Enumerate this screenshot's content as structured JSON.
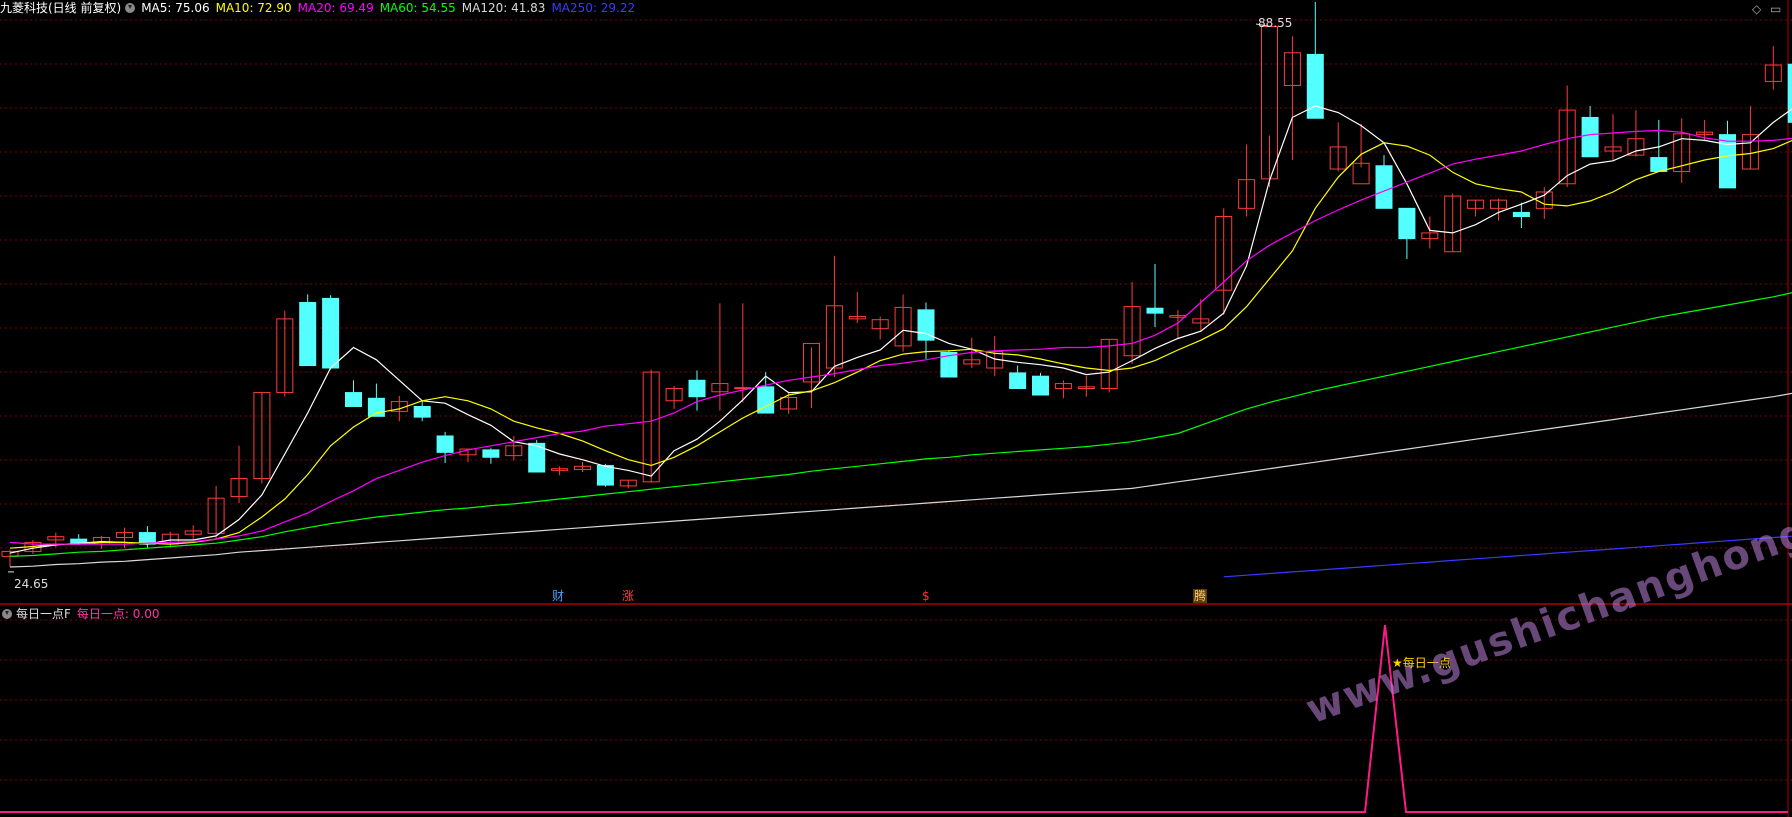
{
  "header": {
    "title": "九菱科技(日线 前复权)",
    "ma": [
      {
        "label": "MA5: 75.06",
        "color": "#ffffff"
      },
      {
        "label": "MA10: 72.90",
        "color": "#ffff00"
      },
      {
        "label": "MA20: 69.49",
        "color": "#ff00ff"
      },
      {
        "label": "MA60: 54.55",
        "color": "#00ff00"
      },
      {
        "label": "MA120: 41.83",
        "color": "#d8d8d8"
      },
      {
        "label": "MA250: 29.22",
        "color": "#3a3aff"
      }
    ]
  },
  "price_labels": {
    "high": "88.55",
    "low": "24.65"
  },
  "event_tags": [
    {
      "text": "财",
      "color": "#4aa3ff"
    },
    {
      "text": "涨",
      "color": "#ff4040"
    },
    {
      "text": "$",
      "color": "#ff3030"
    },
    {
      "text": "腾",
      "color": "#ffcc66"
    }
  ],
  "indicator": {
    "name": "每日一点F",
    "value_label": "每日一点: 0.00",
    "signal_label": "★每日一点"
  },
  "watermark": "www.gushichanghong.com",
  "colors": {
    "up": "#ff3b3b",
    "down": "#54ffff",
    "grid": "#7a0000"
  },
  "chart_data": {
    "type": "candlestick",
    "candles": [
      [
        26.5,
        27.3,
        25.2,
        27.1
      ],
      [
        27.1,
        28.5,
        26.8,
        28.2
      ],
      [
        28.5,
        29.4,
        27.6,
        28.9
      ],
      [
        28.6,
        29.2,
        27.9,
        28.0
      ],
      [
        28.0,
        29.0,
        27.4,
        28.8
      ],
      [
        28.8,
        30.0,
        27.5,
        29.4
      ],
      [
        29.4,
        30.2,
        27.5,
        28.0
      ],
      [
        28.0,
        29.5,
        27.6,
        29.2
      ],
      [
        29.2,
        30.3,
        28.6,
        29.6
      ],
      [
        29.3,
        35.1,
        28.6,
        33.6
      ],
      [
        33.8,
        40.0,
        33.0,
        36.0
      ],
      [
        36.0,
        46.5,
        35.4,
        46.5
      ],
      [
        46.5,
        56.5,
        46.0,
        55.5
      ],
      [
        57.5,
        58.5,
        50.0,
        49.8
      ],
      [
        58.0,
        58.4,
        49.3,
        49.5
      ],
      [
        46.5,
        48.0,
        45.2,
        44.8
      ],
      [
        45.8,
        47.6,
        44.5,
        43.6
      ],
      [
        44.2,
        46.1,
        43.0,
        45.4
      ],
      [
        44.8,
        45.5,
        43.0,
        43.5
      ],
      [
        41.2,
        41.7,
        37.9,
        39.2
      ],
      [
        38.9,
        39.5,
        38.0,
        39.6
      ],
      [
        39.5,
        39.7,
        37.8,
        38.6
      ],
      [
        38.8,
        41.2,
        38.2,
        40.0
      ],
      [
        40.3,
        40.7,
        36.8,
        36.8
      ],
      [
        37.0,
        37.5,
        36.4,
        37.2
      ],
      [
        37.1,
        38.0,
        36.8,
        37.5
      ],
      [
        37.6,
        37.8,
        35.0,
        35.2
      ],
      [
        35.1,
        35.8,
        34.8,
        35.8
      ],
      [
        35.6,
        49.3,
        35.5,
        49.0
      ],
      [
        45.5,
        47.3,
        44.5,
        47.0
      ],
      [
        48.0,
        49.2,
        44.3,
        46.0
      ],
      [
        46.6,
        57.4,
        44.3,
        47.6
      ],
      [
        47.0,
        57.4,
        45.3,
        47.1
      ],
      [
        47.2,
        49.0,
        45.0,
        44.0
      ],
      [
        44.5,
        46.6,
        43.9,
        45.9
      ],
      [
        47.8,
        52.0,
        44.6,
        52.5
      ],
      [
        49.5,
        63.2,
        48.4,
        57.1
      ],
      [
        55.5,
        58.8,
        55.0,
        55.8
      ],
      [
        54.3,
        55.8,
        53.0,
        55.4
      ],
      [
        52.2,
        58.5,
        51.5,
        56.9
      ],
      [
        56.6,
        57.5,
        50.6,
        52.9
      ],
      [
        51.4,
        51.7,
        50.4,
        48.4
      ],
      [
        50.0,
        53.2,
        49.5,
        50.5
      ],
      [
        49.5,
        53.4,
        48.5,
        51.5
      ],
      [
        48.9,
        49.8,
        47.0,
        47.0
      ],
      [
        48.5,
        48.9,
        46.2,
        46.2
      ],
      [
        47.0,
        48.0,
        45.8,
        47.6
      ],
      [
        47.0,
        48.5,
        46.0,
        47.2
      ],
      [
        47.0,
        53.0,
        46.5,
        53.0
      ],
      [
        51.0,
        60.0,
        50.0,
        57.0
      ],
      [
        56.8,
        62.2,
        54.5,
        56.2
      ],
      [
        55.7,
        56.6,
        53.0,
        55.9
      ],
      [
        55.0,
        57.9,
        54.0,
        55.5
      ],
      [
        59.0,
        69.0,
        56.0,
        68.0
      ],
      [
        69.0,
        76.8,
        68.0,
        72.5
      ],
      [
        72.6,
        77.9,
        71.6,
        91.2
      ],
      [
        84.0,
        90.0,
        74.9,
        88.0
      ],
      [
        87.8,
        94.2,
        83.5,
        80.0
      ],
      [
        73.8,
        79.5,
        73.5,
        76.5
      ],
      [
        72.0,
        79.3,
        74.0,
        74.5
      ],
      [
        74.2,
        75.5,
        69.2,
        69.0
      ],
      [
        69.0,
        68.0,
        62.8,
        65.3
      ],
      [
        65.3,
        68.0,
        64.1,
        66.0
      ],
      [
        63.7,
        70.8,
        63.7,
        70.5
      ],
      [
        69.0,
        70.0,
        68.0,
        70.0
      ],
      [
        69.0,
        70.2,
        67.5,
        70.0
      ],
      [
        68.5,
        69.7,
        66.6,
        68.0
      ],
      [
        69.0,
        71.6,
        67.7,
        71.0
      ],
      [
        72.0,
        84.0,
        71.6,
        81.0
      ],
      [
        80.1,
        81.5,
        76.0,
        75.3
      ],
      [
        76.0,
        80.5,
        74.8,
        76.5
      ],
      [
        75.5,
        81.0,
        75.3,
        77.5
      ],
      [
        75.2,
        79.8,
        73.5,
        73.5
      ],
      [
        73.5,
        80.0,
        72.1,
        78.1
      ],
      [
        78.0,
        79.8,
        77.2,
        78.3
      ],
      [
        78.0,
        79.7,
        75.0,
        71.5
      ],
      [
        73.8,
        81.5,
        73.8,
        78.0
      ],
      [
        84.5,
        88.8,
        83.5,
        86.5
      ],
      [
        86.6,
        87.5,
        81.2,
        79.5
      ],
      [
        79.8,
        83.5,
        78.3,
        78.9
      ],
      [
        78.2,
        83.0,
        77.5,
        78.6
      ]
    ],
    "ma_series": [
      {
        "name": "MA5",
        "color": "#ffffff",
        "values": [
          26.9,
          27.5,
          27.9,
          28.1,
          28.3,
          28.2,
          28.0,
          28.5,
          28.5,
          29.0,
          31.0,
          34.0,
          39.0,
          44.0,
          49.5,
          52.0,
          50.5,
          48.0,
          45.5,
          45.2,
          43.8,
          42.5,
          40.5,
          40.0,
          39.0,
          38.3,
          37.5,
          37.0,
          36.3,
          39.4,
          40.8,
          43.0,
          45.6,
          48.5,
          46.5,
          46.6,
          49.7,
          50.8,
          51.7,
          54.1,
          53.7,
          52.5,
          51.8,
          50.6,
          50.2,
          49.9,
          49.5,
          48.7,
          49.0,
          50.4,
          51.9,
          53.1,
          54.0,
          56.2,
          62.0,
          72.4,
          80.1,
          81.5,
          80.7,
          79.1,
          77.0,
          72.0,
          66.3,
          66.0,
          67.0,
          68.5,
          69.5,
          70.6,
          73.0,
          74.4,
          74.8,
          76.0,
          76.5,
          77.5,
          77.3,
          76.8,
          77.0,
          79.5,
          81.5,
          82.0,
          83.8
        ]
      },
      {
        "name": "MA10",
        "color": "#ffff00",
        "values": [
          27.5,
          27.7,
          28.0,
          28.0,
          28.2,
          28.2,
          28.1,
          28.0,
          28.2,
          28.6,
          29.4,
          31.3,
          33.5,
          36.5,
          40.0,
          42.3,
          44.0,
          44.5,
          45.5,
          46.0,
          45.5,
          44.5,
          43.0,
          42.2,
          41.5,
          40.6,
          39.4,
          38.3,
          37.6,
          38.6,
          40.0,
          41.7,
          43.4,
          44.8,
          46.2,
          46.7,
          47.7,
          49.0,
          50.4,
          51.2,
          51.5,
          51.6,
          51.8,
          51.3,
          51.1,
          50.6,
          50.0,
          49.5,
          49.2,
          49.5,
          50.4,
          51.7,
          52.9,
          54.3,
          57.0,
          60.4,
          63.8,
          69.0,
          72.8,
          75.6,
          77.0,
          76.6,
          75.5,
          73.4,
          72.0,
          71.4,
          71.0,
          69.5,
          69.3,
          69.9,
          71.0,
          72.5,
          73.5,
          74.2,
          74.9,
          75.4,
          75.7,
          76.3,
          77.5,
          78.8,
          79.9
        ]
      },
      {
        "name": "MA20",
        "color": "#ff00ff",
        "values": [
          28.2,
          28.0,
          28.0,
          28.0,
          28.0,
          28.0,
          28.1,
          28.2,
          28.3,
          28.6,
          29.0,
          29.6,
          30.7,
          31.8,
          33.2,
          34.5,
          36.0,
          37.0,
          38.0,
          38.8,
          39.5,
          40.0,
          40.5,
          41.0,
          41.5,
          41.8,
          42.4,
          42.7,
          43.0,
          44.0,
          45.4,
          46.2,
          46.8,
          47.4,
          48.0,
          48.4,
          48.8,
          49.3,
          49.8,
          50.1,
          50.5,
          51.0,
          51.4,
          51.6,
          51.7,
          51.8,
          52.0,
          52.0,
          52.2,
          52.5,
          53.5,
          55.0,
          57.5,
          60.0,
          62.6,
          64.5,
          66.0,
          67.5,
          68.8,
          70.0,
          71.1,
          72.2,
          73.3,
          74.4,
          75.0,
          75.5,
          76.0,
          76.8,
          77.5,
          78.0,
          78.2,
          78.4,
          78.5,
          78.3,
          77.6,
          77.2,
          77.2,
          77.3,
          77.6,
          78.3,
          79.0
        ]
      },
      {
        "name": "MA60",
        "color": "#00ff00",
        "values": [
          26.5,
          26.6,
          26.8,
          27.0,
          27.1,
          27.3,
          27.5,
          27.7,
          27.9,
          28.1,
          28.5,
          28.9,
          29.5,
          30.0,
          30.5,
          30.9,
          31.3,
          31.6,
          31.9,
          32.2,
          32.4,
          32.7,
          32.9,
          33.2,
          33.5,
          33.8,
          34.1,
          34.4,
          34.7,
          35.0,
          35.3,
          35.6,
          35.9,
          36.2,
          36.5,
          36.9,
          37.2,
          37.5,
          37.8,
          38.1,
          38.4,
          38.6,
          38.9,
          39.1,
          39.3,
          39.5,
          39.7,
          39.9,
          40.2,
          40.5,
          41.0,
          41.5,
          42.5,
          43.5,
          44.5,
          45.3,
          46.0,
          46.7,
          47.3,
          47.9,
          48.5,
          49.1,
          49.7,
          50.3,
          50.9,
          51.5,
          52.1,
          52.7,
          53.3,
          53.9,
          54.5,
          55.1,
          55.7,
          56.2,
          56.7,
          57.2,
          57.7,
          58.2,
          58.8,
          59.5,
          60.2
        ]
      },
      {
        "name": "MA120",
        "color": "#d8d8d8",
        "values": [
          25.2,
          25.3,
          25.5,
          25.6,
          25.8,
          25.9,
          26.1,
          26.3,
          26.5,
          26.7,
          27.0,
          27.2,
          27.4,
          27.6,
          27.8,
          28.0,
          28.2,
          28.4,
          28.6,
          28.8,
          29.0,
          29.2,
          29.4,
          29.6,
          29.8,
          30.0,
          30.2,
          30.4,
          30.6,
          30.8,
          31.0,
          31.2,
          31.4,
          31.6,
          31.8,
          32.0,
          32.2,
          32.4,
          32.6,
          32.8,
          33.0,
          33.2,
          33.4,
          33.6,
          33.8,
          34.0,
          34.2,
          34.4,
          34.6,
          34.8,
          35.2,
          35.6,
          36.0,
          36.4,
          36.8,
          37.2,
          37.6,
          38.0,
          38.4,
          38.8,
          39.2,
          39.6,
          40.0,
          40.4,
          40.8,
          41.2,
          41.6,
          42.0,
          42.4,
          42.8,
          43.2,
          43.6,
          44.0,
          44.4,
          44.8,
          45.2,
          45.6,
          46.0,
          46.5,
          47.0,
          47.5
        ]
      },
      {
        "name": "MA250",
        "color": "#3a3aff",
        "values": [
          null,
          null,
          null,
          null,
          null,
          null,
          null,
          null,
          null,
          null,
          null,
          null,
          null,
          null,
          null,
          null,
          null,
          null,
          null,
          null,
          null,
          null,
          null,
          null,
          null,
          null,
          null,
          null,
          null,
          null,
          null,
          null,
          null,
          null,
          null,
          null,
          null,
          null,
          null,
          null,
          null,
          null,
          null,
          null,
          null,
          null,
          null,
          null,
          null,
          null,
          null,
          null,
          null,
          24.0,
          24.2,
          24.4,
          24.6,
          24.8,
          25.0,
          25.2,
          25.4,
          25.6,
          25.8,
          26.0,
          26.2,
          26.4,
          26.6,
          26.8,
          27.0,
          27.2,
          27.4,
          27.6,
          27.8,
          28.0,
          28.2,
          28.4,
          28.6,
          28.8,
          29.0,
          29.2,
          29.4
        ]
      }
    ],
    "price_range": [
      23,
      92
    ],
    "indicator_series": {
      "values_nonzero_index": 61,
      "peak": 1,
      "range": [
        0,
        1
      ]
    }
  }
}
